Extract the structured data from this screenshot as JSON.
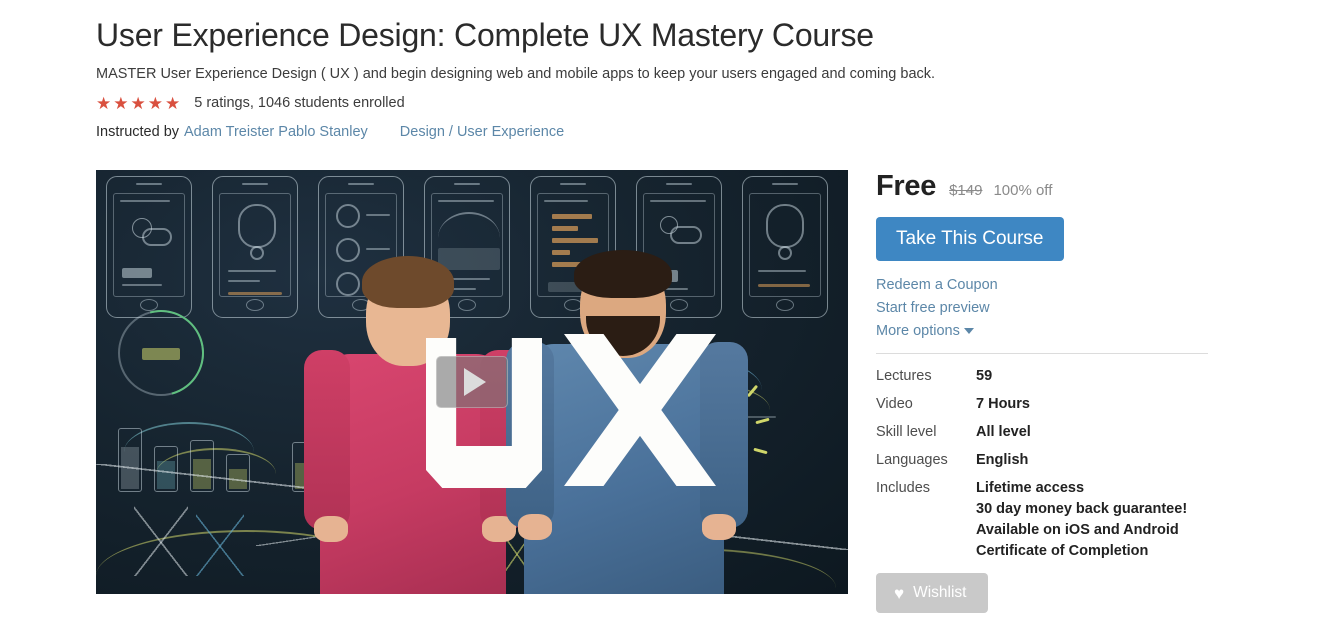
{
  "course": {
    "title": "User Experience Design: Complete UX Mastery Course",
    "subtitle": "MASTER User Experience Design ( UX ) and begin designing web and mobile apps to keep your users engaged and coming back.",
    "rating_stars": 5,
    "star_glyph": "★",
    "star_color": "#d9503f",
    "rating_text": "5 ratings, 1046 students enrolled",
    "instructed_by_label": "Instructed by",
    "instructors": "Adam Treister Pablo Stanley",
    "category": "Design",
    "category_separator": "/",
    "subcategory": "User Experience"
  },
  "video": {
    "alt": "Two instructors holding large white U and X letters in front of a chalkboard covered with UI wireframe sketches",
    "play_icon": "play-triangle-icon"
  },
  "pricing": {
    "current_price": "Free",
    "original_price": "$149",
    "discount": "100% off",
    "cta_label": "Take This Course",
    "cta_color": "#3e87c3",
    "links": [
      {
        "label": "Redeem a Coupon",
        "icon": null
      },
      {
        "label": "Start free preview",
        "icon": null
      },
      {
        "label": "More options",
        "icon": "caret-down-icon"
      }
    ],
    "link_color": "#5c87a8"
  },
  "details": {
    "rows": [
      {
        "key": "Lectures",
        "values": [
          "59"
        ]
      },
      {
        "key": "Video",
        "values": [
          "7 Hours"
        ]
      },
      {
        "key": "Skill level",
        "values": [
          "All level"
        ]
      },
      {
        "key": "Languages",
        "values": [
          "English"
        ]
      },
      {
        "key": "Includes",
        "values": [
          "Lifetime access",
          "30 day money back guarantee!",
          "Available on iOS and Android",
          "Certificate of Completion"
        ]
      }
    ]
  },
  "wishlist": {
    "label": "Wishlist",
    "icon": "heart-icon",
    "heart_glyph": "♥",
    "background": "#c9c9c9"
  }
}
